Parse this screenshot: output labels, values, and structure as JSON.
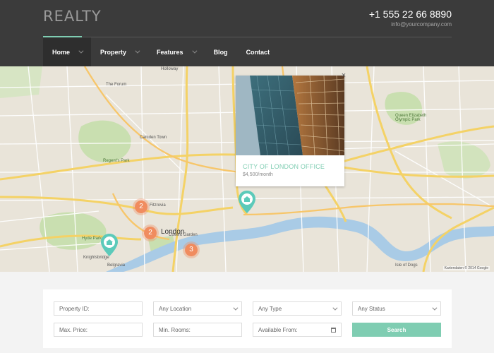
{
  "brand": {
    "logo": "REALTY",
    "phone": "+1 555 22 66 8890",
    "email": "info@yourcompany.com"
  },
  "nav": [
    {
      "label": "Home",
      "active": true,
      "dropdown": true
    },
    {
      "label": "Property",
      "active": false,
      "dropdown": true
    },
    {
      "label": "Features",
      "active": false,
      "dropdown": true
    },
    {
      "label": "Blog",
      "active": false,
      "dropdown": false
    },
    {
      "label": "Contact",
      "active": false,
      "dropdown": false
    }
  ],
  "map": {
    "attribution": "Kartendaten © 2014 Google",
    "labels": [
      "The Forum",
      "Regent's Park",
      "Camden Town",
      "Fitzrovia",
      "Covent Garden",
      "London",
      "Hyde Park",
      "Knightsbridge",
      "Belgravia",
      "Queen Elizabeth Olympic Park",
      "Isle of Dogs",
      "Holloway"
    ],
    "clusters": [
      "2",
      "2",
      "3"
    ]
  },
  "popup": {
    "title": "CITY OF LONDON OFFICE",
    "price": "$4,500/month",
    "close": "×"
  },
  "search": {
    "property_id": "Property ID:",
    "location": "Any Location",
    "type": "Any Type",
    "status": "Any Status",
    "max_price": "Max. Price:",
    "min_rooms": "Min. Rooms:",
    "available_from": "Available From:",
    "button": "Search"
  },
  "colors": {
    "accent": "#7fcdb2",
    "marker": "#f08c5f",
    "header": "#3b3b3b"
  }
}
